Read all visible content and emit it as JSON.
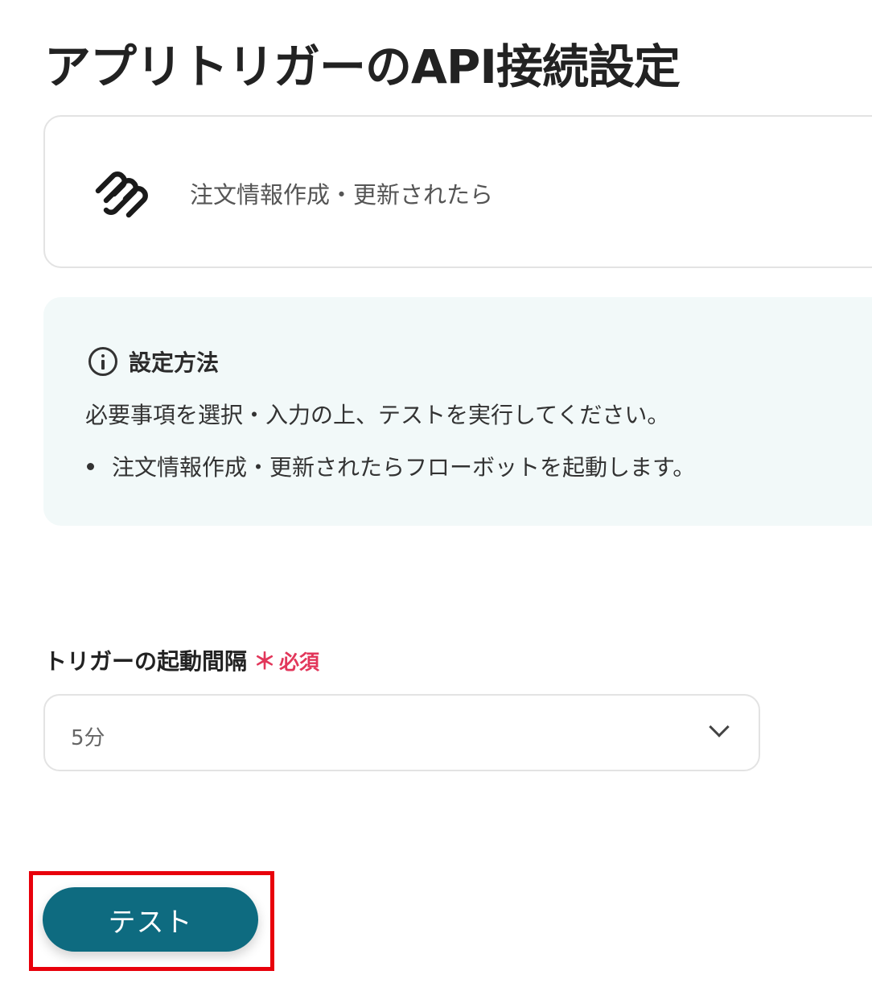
{
  "page": {
    "title": "アプリトリガーのAPI接続設定"
  },
  "trigger": {
    "icon": "squarespace-logo-icon",
    "label": "注文情報作成・更新されたら"
  },
  "info": {
    "heading": "設定方法",
    "description": "必要事項を選択・入力の上、テストを実行してください。",
    "bullets": [
      "注文情報作成・更新されたらフローボットを起動します。"
    ]
  },
  "interval_field": {
    "label": "トリガーの起動間隔",
    "required_mark": "＊",
    "required_text": "必須",
    "selected_value": "5分"
  },
  "actions": {
    "test_label": "テスト"
  },
  "colors": {
    "primary_button": "#0e6b80",
    "required": "#e2365a",
    "highlight_frame": "#e8000b",
    "info_bg": "#f2f9f9"
  }
}
